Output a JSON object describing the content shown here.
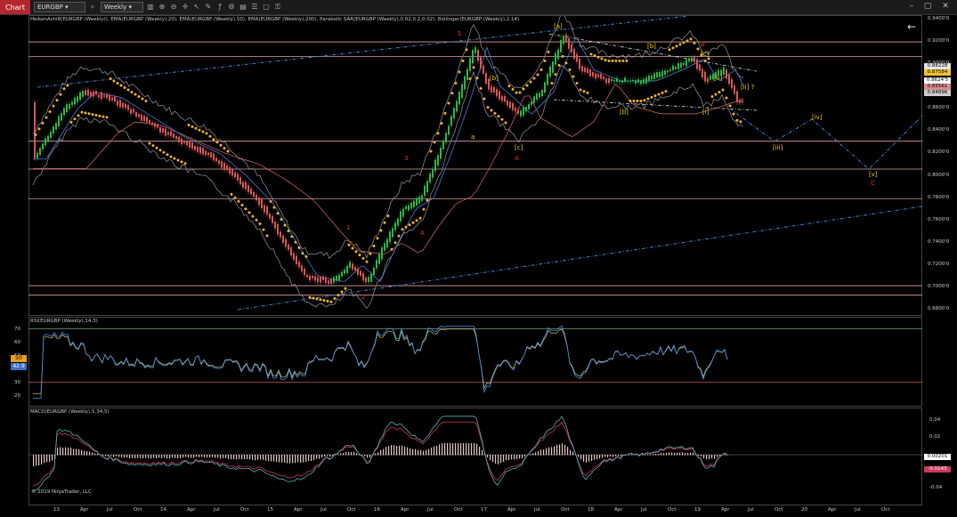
{
  "toolbar": {
    "chart_tab": "Chart",
    "instrument": "EURGBP",
    "interval": "Weekly"
  },
  "main_pane": {
    "title": "HeikenAshi8(EURGBP (Weekly)), EMA(EURGBP (Weekly),20), EMA(EURGBP (Weekly),50), EMA(EURGBP (Weekly),200), Parabolic SAR(EURGBP (Weekly),0.02,0.2,0.02), Bollinger(EURGBP (Weekly),2,14)",
    "price_ticks": [
      "0.9400'0",
      "0.9200'0",
      "0.9000'0",
      "0.8800'0",
      "0.8600'0",
      "0.8400'0",
      "0.8200'0",
      "0.8000'0",
      "0.7800'0",
      "0.7600'0",
      "0.7400'0",
      "0.7200'0",
      "0.7000'0",
      "0.6800'0"
    ],
    "price_boxes": [
      {
        "text": "0.88228",
        "color": "#e6e6e6"
      },
      {
        "text": "0.87584",
        "color": "#f0c030"
      },
      {
        "text": "0.8624'5",
        "color": "#ffffff"
      },
      {
        "text": "0.85561",
        "color": "#d88a8a"
      },
      {
        "text": "0.84896",
        "color": "#cccccc"
      }
    ],
    "wave_labels": [
      {
        "text": "5",
        "color": "#e03030"
      },
      {
        "text": "[a]",
        "color": "#f0d000"
      },
      {
        "text": "[b]",
        "color": "#f0d000"
      },
      {
        "text": "a",
        "color": "#f0d000"
      },
      {
        "text": "[c]",
        "color": "#f0d000"
      },
      {
        "text": "A",
        "color": "#e03030"
      },
      {
        "text": "3",
        "color": "#e03030"
      },
      {
        "text": "4",
        "color": "#e03030"
      },
      {
        "text": "1",
        "color": "#e03030"
      },
      {
        "text": "2",
        "color": "#e03030"
      },
      {
        "text": "B",
        "color": "#e03030"
      },
      {
        "text": "[c]",
        "color": "#f0d000"
      },
      {
        "text": "[ii]",
        "color": "#f0d000"
      },
      {
        "text": "[ii] ?",
        "color": "#f0d000"
      },
      {
        "text": "[b]",
        "color": "#f0d000"
      },
      {
        "text": "[i]",
        "color": "#f0d000"
      },
      {
        "text": "[iii]",
        "color": "#f0d000"
      },
      {
        "text": "[iv]",
        "color": "#f0d000"
      },
      {
        "text": "[v]",
        "color": "#f0d000"
      },
      {
        "text": "C",
        "color": "#e03030"
      },
      {
        "text": "[b]",
        "color": "#f0d000"
      }
    ]
  },
  "rsi_pane": {
    "title": "RSI(EURGBP (Weekly),14,3)",
    "ticks": [
      "70",
      "60",
      "50",
      "40",
      "30",
      "20"
    ],
    "value_box": "50",
    "value_box2": "42.9"
  },
  "macd_pane": {
    "title": "MACD(EURGBP (Weekly),5,34,5)",
    "ticks": [
      "0.04",
      "0.02",
      "-0.02",
      "-0.04"
    ],
    "value_boxes": [
      "0.00201",
      "-0.0143"
    ],
    "copyright": "© 2019 NinjaTrader, LLC"
  },
  "time_axis": [
    "13",
    "Apr",
    "Jul",
    "Oct",
    "14",
    "Apr",
    "Jul",
    "Oct",
    "15",
    "Apr",
    "Jul",
    "Oct",
    "16",
    "Apr",
    "Jul",
    "Oct",
    "17",
    "Apr",
    "Jul",
    "Oct",
    "18",
    "Apr",
    "Jul",
    "Oct",
    "19",
    "Apr",
    "Jul",
    "Oct",
    "20",
    "Apr",
    "Jul",
    "Oct"
  ],
  "colors": {
    "bull": "#2db84a",
    "bear": "#d8585a",
    "sar": "#f2b230",
    "ema20": "#4a78d8",
    "ema200": "#c06060",
    "band": "#9a9a9a",
    "channel": "#4a7fd0",
    "hline": "#e0a0a0"
  }
}
